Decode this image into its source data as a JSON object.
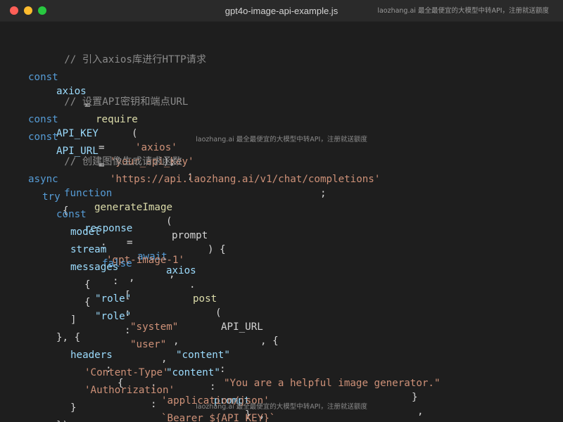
{
  "window": {
    "title": "gpt4o-image-api-example.js",
    "watermark": "laozhang.ai 最全最便宜的大模型中转API，注册就送额度"
  },
  "code": {
    "comment_import": "// 引入axios库进行HTTP请求",
    "comment_config": "// 设置API密钥和端点URL",
    "comment_func": "// 创建图像生成请求函数",
    "kw_const": "const",
    "kw_async": "async",
    "kw_function": "function",
    "kw_try": "try",
    "kw_await": "await",
    "id_axios": "axios",
    "id_require": "require",
    "id_api_key": "API_KEY",
    "id_api_url": "API_URL",
    "id_generate": "generateImage",
    "id_prompt": "prompt",
    "id_response": "response",
    "id_post": "post",
    "prop_model": "model",
    "prop_stream": "stream",
    "prop_messages": "messages",
    "prop_headers": "headers",
    "prop_role": "\"role\"",
    "prop_content": "\"content\"",
    "val_false": "false",
    "str_axios": "'axios'",
    "str_key": "'your_api_key'",
    "str_url": "'https://api.laozhang.ai/v1/chat/completions'",
    "str_model": "'gpt-image-1'",
    "str_system": "\"system\"",
    "str_user": "\"user\"",
    "str_helpful": "\"You are a helpful image generator.\"",
    "str_ct_key": "'Content-Type'",
    "str_ct_val": "'application/json'",
    "str_auth_key": "'Authorization'",
    "str_auth_val": "`Bearer ${API_KEY}`",
    "p_eq": "=",
    "p_open_paren": "(",
    "p_close_paren": ")",
    "p_close_semi": ");",
    "p_semi": ";",
    "p_colon": ":",
    "p_comma": ",",
    "p_brace": "{",
    "p_paren_brace": ") {",
    "p_open_bracket": "[",
    "p_close_bracket": "]",
    "p_close_brace": "}",
    "p_close_brace_comma_open": "}, {",
    "p_close_all": "});",
    "p_dot": ".",
    "p_comma_open": ", {"
  }
}
